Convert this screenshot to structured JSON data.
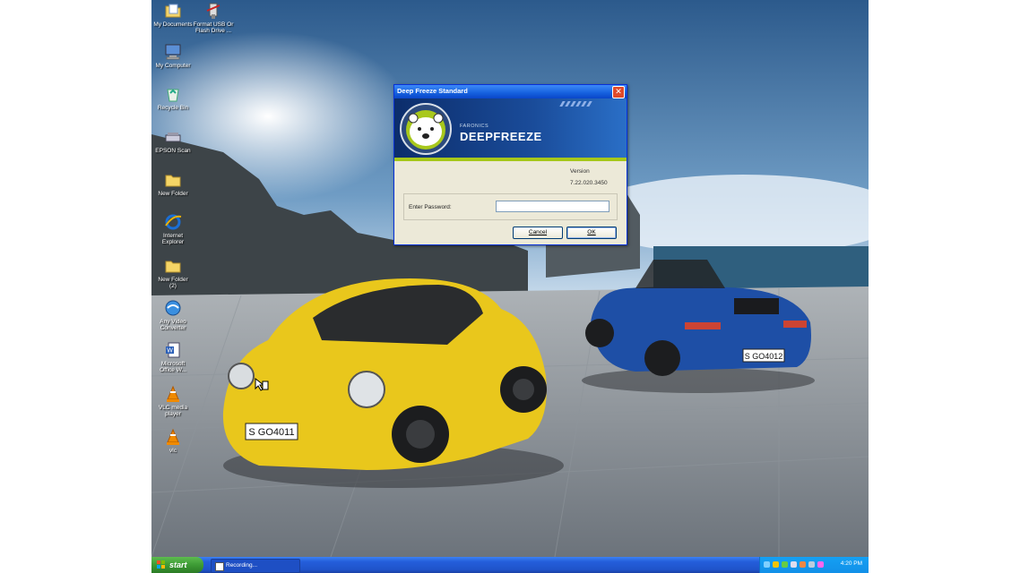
{
  "desktop_icons": [
    {
      "label": "My Documents",
      "icon": "documents-folder-icon"
    },
    {
      "label": "Format USB Or\nFlash Drive ...",
      "icon": "usb-tool-icon"
    },
    {
      "label": "My Computer",
      "icon": "computer-icon"
    },
    {
      "label": "Recycle Bin",
      "icon": "recycle-bin-icon"
    },
    {
      "label": "EPSON Scan",
      "icon": "scanner-icon"
    },
    {
      "label": "New Folder",
      "icon": "folder-icon"
    },
    {
      "label": "Internet\nExplorer",
      "icon": "internet-explorer-icon"
    },
    {
      "label": "New Folder\n(2)",
      "icon": "folder-icon"
    },
    {
      "label": "Any Video\nConverter",
      "icon": "video-converter-icon"
    },
    {
      "label": "Microsoft\nOffice W...",
      "icon": "word-document-icon"
    },
    {
      "label": "VLC media\nplayer",
      "icon": "vlc-icon"
    },
    {
      "label": "vlc",
      "icon": "vlc-icon"
    }
  ],
  "dialog": {
    "title": "Deep Freeze Standard",
    "brand_small": "FARONICS",
    "brand_big": "DEEPFREEZE",
    "version_label": "Version",
    "version_value": "7.22.020.3450",
    "password_label": "Enter Password:",
    "password_value": "",
    "cancel_label": "Cancel",
    "ok_label": "OK"
  },
  "taskbar": {
    "start_label": "start",
    "tasks": [
      {
        "label": "Recording..."
      }
    ],
    "clock": "4:20 PM"
  },
  "colors": {
    "titlebar": "#1560de",
    "taskbar": "#245edb",
    "start_button": "#3d9b35",
    "close_button": "#e04a2a",
    "banner_accent": "#a6c71a"
  }
}
